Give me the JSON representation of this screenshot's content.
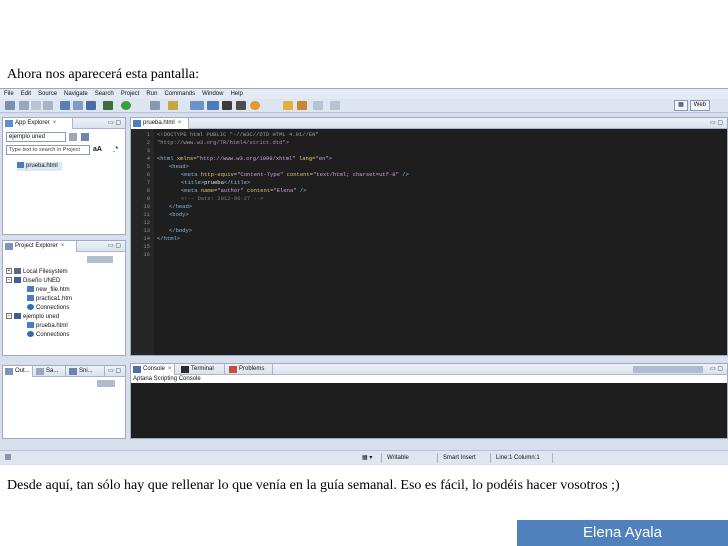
{
  "slide": {
    "caption_top": "Ahora nos aparecerá esta pantalla:",
    "caption_bottom": "Desde aquí, tan sólo hay que rellenar lo que venía en la guía semanal. Eso es fácil, lo podéis hacer vosotros ;)",
    "author": "Elena Ayala"
  },
  "ide": {
    "menu": [
      "File",
      "Edit",
      "Source",
      "Navigate",
      "Search",
      "Project",
      "Run",
      "Commands",
      "Window",
      "Help"
    ],
    "perspective_label": "Web",
    "app_explorer": {
      "tab": "App Explorer",
      "project_select": "ejemplo uned",
      "search_placeholder": "Type text to search in Project",
      "font_controls": "aA",
      "file": "prueba.html"
    },
    "project_explorer": {
      "tab": "Project Explorer",
      "items": [
        {
          "label": "Local Filesystem"
        },
        {
          "label": "Diseño UNED"
        },
        {
          "label": "new_file.htm"
        },
        {
          "label": "practica1.htm"
        },
        {
          "label": "Connections"
        },
        {
          "label": "ejemplo uned"
        },
        {
          "label": "prueba.html"
        },
        {
          "label": "Connections"
        }
      ]
    },
    "bottom_left_tabs": [
      "Out...",
      "Sa...",
      "Sni..."
    ],
    "editor": {
      "tab": "prueba.html",
      "line_numbers": [
        "1",
        "2",
        "3",
        "4",
        "5",
        "6",
        "7",
        "8",
        "9",
        "10",
        "11",
        "12",
        "13",
        "14",
        "15",
        "16"
      ],
      "lines": {
        "l1": "<!DOCTYPE html PUBLIC \"-//W3C//DTD HTML 4.01//EN\"",
        "l2": "\"http://www.w3.org/TR/html4/strict.dtd\">",
        "l4a": "<html",
        "l4b": " xmlns=",
        "l4c": "\"http://www.w3.org/1999/xhtml\"",
        "l4d": " lang=",
        "l4e": "\"en\"",
        "l4f": ">",
        "l5": "<head>",
        "l6a": "<meta",
        "l6b": " http-equiv=",
        "l6c": "\"Content-Type\"",
        "l6d": " content=",
        "l6e": "\"text/html; charset=utf-8\"",
        "l6f": " />",
        "l7a": "<title>",
        "l7b": "prueba",
        "l7c": "</title>",
        "l8a": "<meta",
        "l8b": " name=",
        "l8c": "\"author\"",
        "l8d": " content=",
        "l8e": "\"Elena\"",
        "l8f": " />",
        "l9": "<!-- Date: 2012-06-27 -->",
        "l10": "</head>",
        "l11": "<body>",
        "l13": "</body>",
        "l14": "</html>"
      }
    },
    "console": {
      "tabs": [
        "Console",
        "Terminal",
        "Problems"
      ],
      "title": "Aptana Scripting Console"
    },
    "status": {
      "writable": "Writable",
      "insert_mode": "Smart Insert",
      "position": "Line:1 Column:1"
    }
  }
}
